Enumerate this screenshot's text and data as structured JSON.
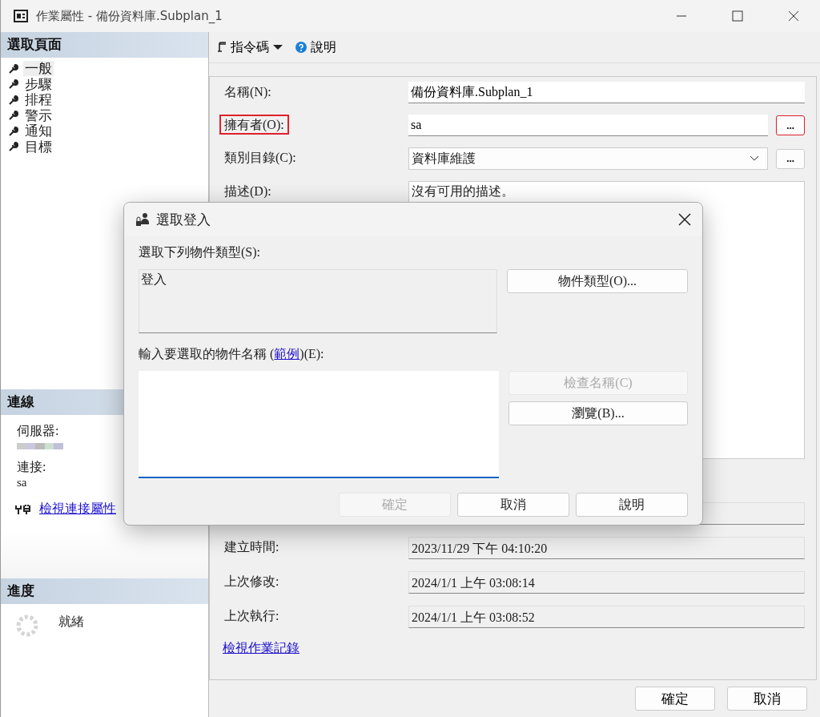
{
  "window": {
    "title": "作業屬性 - 備份資料庫.Subplan_1"
  },
  "sidebar": {
    "header": "選取頁面",
    "pages": [
      {
        "label": "一般",
        "selected": true
      },
      {
        "label": "步驟",
        "selected": false
      },
      {
        "label": "排程",
        "selected": false
      },
      {
        "label": "警示",
        "selected": false
      },
      {
        "label": "通知",
        "selected": false
      },
      {
        "label": "目標",
        "selected": false
      }
    ],
    "connection": {
      "header": "連線",
      "server_label": "伺服器:",
      "connection_label": "連接:",
      "connection_value": "sa",
      "link": "檢視連接屬性"
    },
    "progress": {
      "header": "進度",
      "status": "就緒"
    }
  },
  "toolbar": {
    "script_button": "指令碼",
    "help_button": "說明"
  },
  "form": {
    "fields": [
      {
        "kind": "text",
        "label": "名稱(N):",
        "value": "備份資料庫.Subplan_1"
      },
      {
        "kind": "text_browse",
        "label": "擁有者(O):",
        "value": "sa",
        "button": "...",
        "highlighted": true
      },
      {
        "kind": "combo",
        "label": "類別目錄(C):",
        "value": "資料庫維護",
        "button": "..."
      },
      {
        "kind": "textarea",
        "label": "描述(D):",
        "value": "沒有可用的描述。"
      },
      {
        "kind": "readonly"
      },
      {
        "kind": "readonly",
        "label": "建立時間:",
        "value": "2023/11/29 下午 04:10:20"
      },
      {
        "kind": "readonly",
        "label": "上次修改:",
        "value": "2024/1/1 上午 03:08:14"
      },
      {
        "kind": "readonly",
        "label": "上次執行:",
        "value": "2024/1/1 上午 03:08:52"
      }
    ],
    "history_link": "檢視作業記錄"
  },
  "footer_buttons": [
    {
      "label": "確定"
    },
    {
      "label": "取消"
    }
  ],
  "dialog": {
    "title": "選取登入",
    "object_types_label": "選取下列物件類型(S):",
    "object_types_value": "登入",
    "object_types_button": "物件類型(O)...",
    "names_label": {
      "before": "輸入要選取的物件名稱 (",
      "link": "範例",
      "after": ")(E):"
    },
    "side_buttons": [
      {
        "label": "檢查名稱(C)",
        "disabled": true
      },
      {
        "label": "瀏覽(B)...",
        "disabled": false
      }
    ],
    "buttons": [
      {
        "label": "確定",
        "disabled": true
      },
      {
        "label": "取消",
        "disabled": false
      },
      {
        "label": "說明",
        "disabled": false
      }
    ]
  }
}
